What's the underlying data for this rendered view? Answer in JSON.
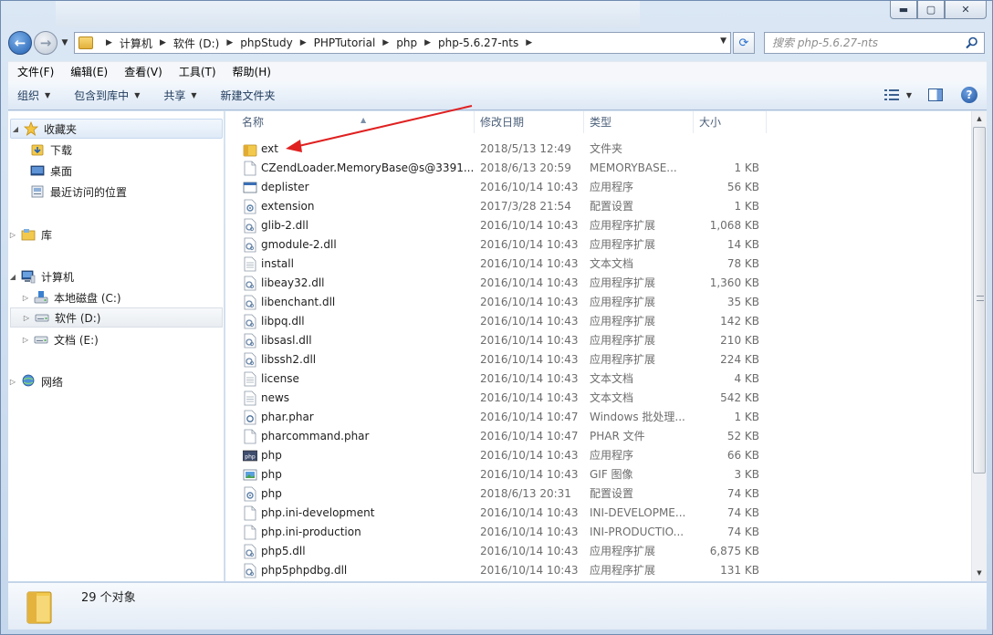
{
  "window": {
    "caption_buttons": {
      "minimize": "▬",
      "maximize": "▢",
      "close": "✕"
    }
  },
  "address_bar": {
    "breadcrumbs": [
      "计算机",
      "软件 (D:)",
      "phpStudy",
      "PHPTutorial",
      "php",
      "php-5.6.27-nts"
    ]
  },
  "search": {
    "placeholder": "搜索 php-5.6.27-nts"
  },
  "menu": [
    "文件(F)",
    "编辑(E)",
    "查看(V)",
    "工具(T)",
    "帮助(H)"
  ],
  "toolbar": {
    "organize": "组织",
    "include_library": "包含到库中",
    "share": "共享",
    "new_folder": "新建文件夹"
  },
  "nav": {
    "favorites": "收藏夹",
    "downloads": "下载",
    "desktop": "桌面",
    "recent": "最近访问的位置",
    "libraries": "库",
    "computer": "计算机",
    "drive_c": "本地磁盘 (C:)",
    "drive_d": "软件 (D:)",
    "drive_e": "文档 (E:)",
    "network": "网络"
  },
  "columns": {
    "name": "名称",
    "date": "修改日期",
    "type": "类型",
    "size": "大小"
  },
  "files": [
    {
      "name": "ext",
      "date": "2018/5/13 12:49",
      "type": "文件夹",
      "size": "",
      "icon": "folder-icon"
    },
    {
      "name": "CZendLoader.MemoryBase@s@3391...",
      "date": "2018/6/13 20:59",
      "type": "MEMORYBASE...",
      "size": "1 KB",
      "icon": "blank-file-icon"
    },
    {
      "name": "deplister",
      "date": "2016/10/14 10:43",
      "type": "应用程序",
      "size": "56 KB",
      "icon": "exe-icon"
    },
    {
      "name": "extension",
      "date": "2017/3/28 21:54",
      "type": "配置设置",
      "size": "1 KB",
      "icon": "config-icon"
    },
    {
      "name": "glib-2.dll",
      "date": "2016/10/14 10:43",
      "type": "应用程序扩展",
      "size": "1,068 KB",
      "icon": "dll-icon"
    },
    {
      "name": "gmodule-2.dll",
      "date": "2016/10/14 10:43",
      "type": "应用程序扩展",
      "size": "14 KB",
      "icon": "dll-icon"
    },
    {
      "name": "install",
      "date": "2016/10/14 10:43",
      "type": "文本文档",
      "size": "78 KB",
      "icon": "text-file-icon"
    },
    {
      "name": "libeay32.dll",
      "date": "2016/10/14 10:43",
      "type": "应用程序扩展",
      "size": "1,360 KB",
      "icon": "dll-icon"
    },
    {
      "name": "libenchant.dll",
      "date": "2016/10/14 10:43",
      "type": "应用程序扩展",
      "size": "35 KB",
      "icon": "dll-icon"
    },
    {
      "name": "libpq.dll",
      "date": "2016/10/14 10:43",
      "type": "应用程序扩展",
      "size": "142 KB",
      "icon": "dll-icon"
    },
    {
      "name": "libsasl.dll",
      "date": "2016/10/14 10:43",
      "type": "应用程序扩展",
      "size": "210 KB",
      "icon": "dll-icon"
    },
    {
      "name": "libssh2.dll",
      "date": "2016/10/14 10:43",
      "type": "应用程序扩展",
      "size": "224 KB",
      "icon": "dll-icon"
    },
    {
      "name": "license",
      "date": "2016/10/14 10:43",
      "type": "文本文档",
      "size": "4 KB",
      "icon": "text-file-icon"
    },
    {
      "name": "news",
      "date": "2016/10/14 10:43",
      "type": "文本文档",
      "size": "542 KB",
      "icon": "text-file-icon"
    },
    {
      "name": "phar.phar",
      "date": "2016/10/14 10:47",
      "type": "Windows 批处理...",
      "size": "1 KB",
      "icon": "batch-icon"
    },
    {
      "name": "pharcommand.phar",
      "date": "2016/10/14 10:47",
      "type": "PHAR 文件",
      "size": "52 KB",
      "icon": "blank-file-icon"
    },
    {
      "name": "php",
      "date": "2016/10/14 10:43",
      "type": "应用程序",
      "size": "66 KB",
      "icon": "php-exe-icon"
    },
    {
      "name": "php",
      "date": "2016/10/14 10:43",
      "type": "GIF 图像",
      "size": "3 KB",
      "icon": "image-icon"
    },
    {
      "name": "php",
      "date": "2018/6/13 20:31",
      "type": "配置设置",
      "size": "74 KB",
      "icon": "config-icon"
    },
    {
      "name": "php.ini-development",
      "date": "2016/10/14 10:43",
      "type": "INI-DEVELOPME...",
      "size": "74 KB",
      "icon": "blank-file-icon"
    },
    {
      "name": "php.ini-production",
      "date": "2016/10/14 10:43",
      "type": "INI-PRODUCTIO...",
      "size": "74 KB",
      "icon": "blank-file-icon"
    },
    {
      "name": "php5.dll",
      "date": "2016/10/14 10:43",
      "type": "应用程序扩展",
      "size": "6,875 KB",
      "icon": "dll-icon"
    },
    {
      "name": "php5phpdbg.dll",
      "date": "2016/10/14 10:43",
      "type": "应用程序扩展",
      "size": "131 KB",
      "icon": "dll-icon"
    }
  ],
  "status": {
    "count": "29 个对象"
  },
  "colors": {
    "annotation_arrow": "#e02020",
    "selection": "#dfeaf7",
    "folder": "#f2c94c"
  }
}
